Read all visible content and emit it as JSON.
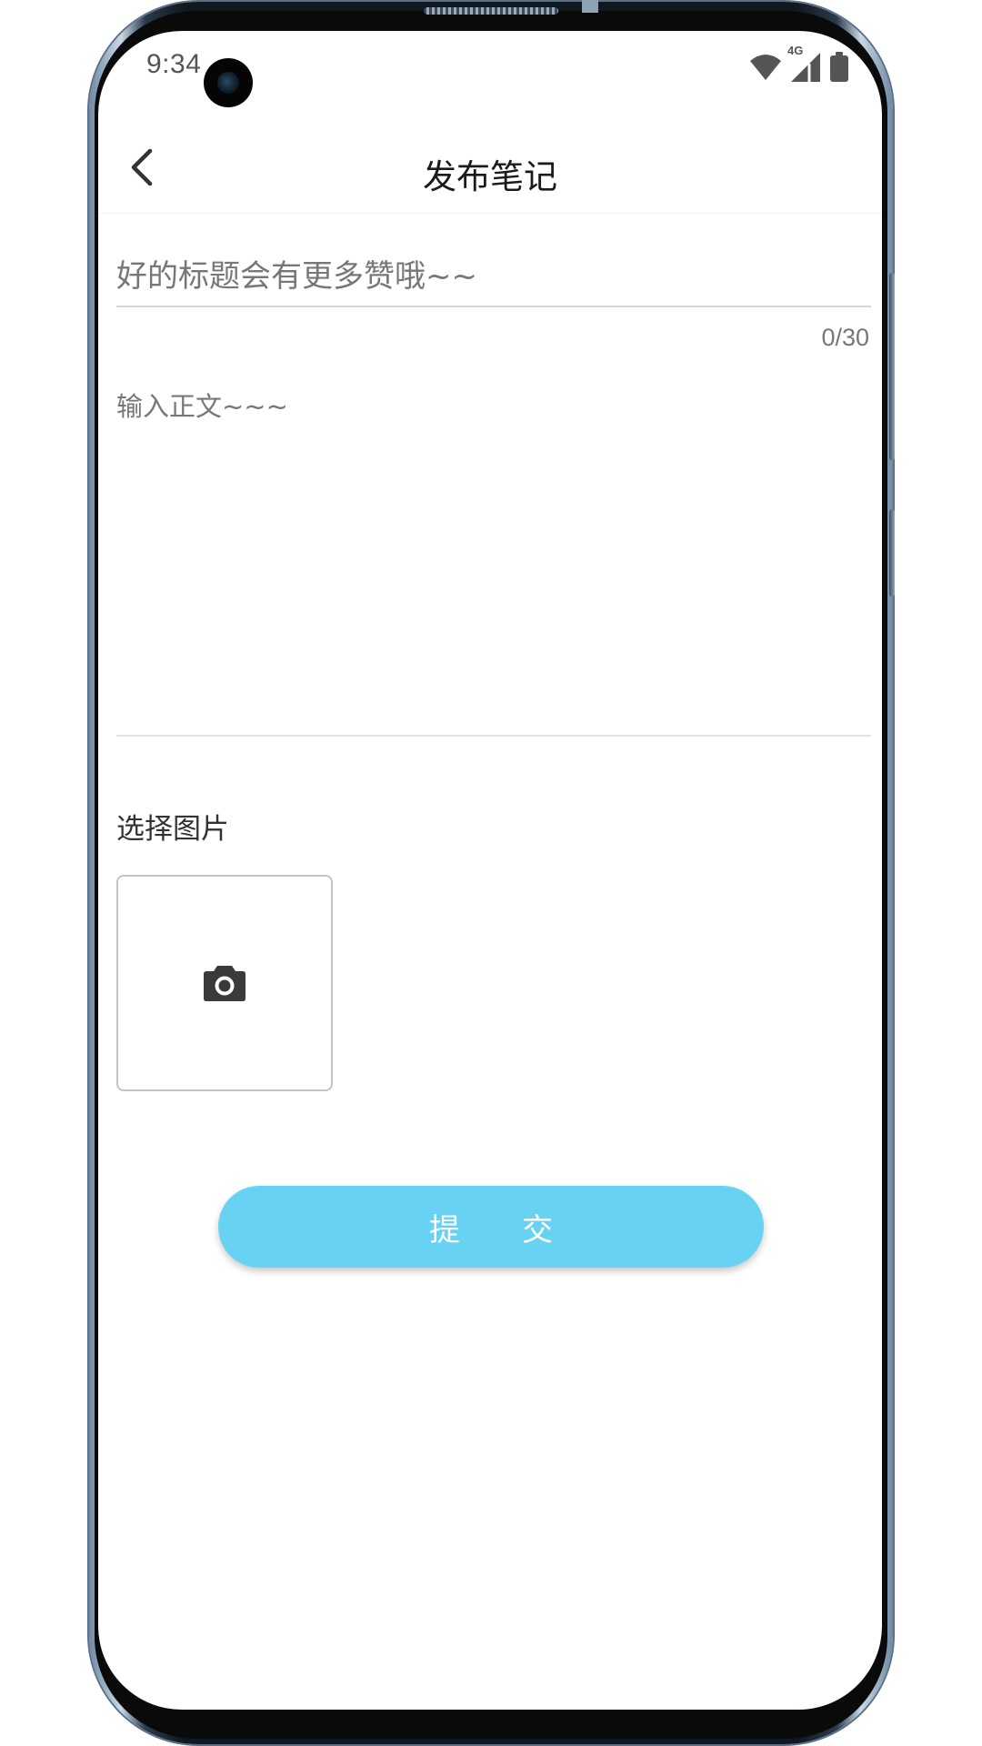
{
  "status_bar": {
    "time": "9:34",
    "network_label": "4G"
  },
  "header": {
    "title": "发布笔记"
  },
  "form": {
    "title_placeholder": "好的标题会有更多赞哦~~",
    "title_value": "",
    "title_counter": "0/30",
    "body_placeholder": "输入正文~~~",
    "body_value": "",
    "image_section_label": "选择图片",
    "submit_label": "提交"
  },
  "icons": {
    "back": "chevron-left-icon",
    "camera": "camera-icon",
    "wifi": "wifi-icon",
    "signal": "signal-icon",
    "battery": "battery-icon"
  },
  "colors": {
    "submit_button": "#67d2f1",
    "title_text": "#1a1a1a",
    "placeholder": "#777777",
    "divider": "#d6d6d6",
    "icon": "#3a3a3a"
  }
}
